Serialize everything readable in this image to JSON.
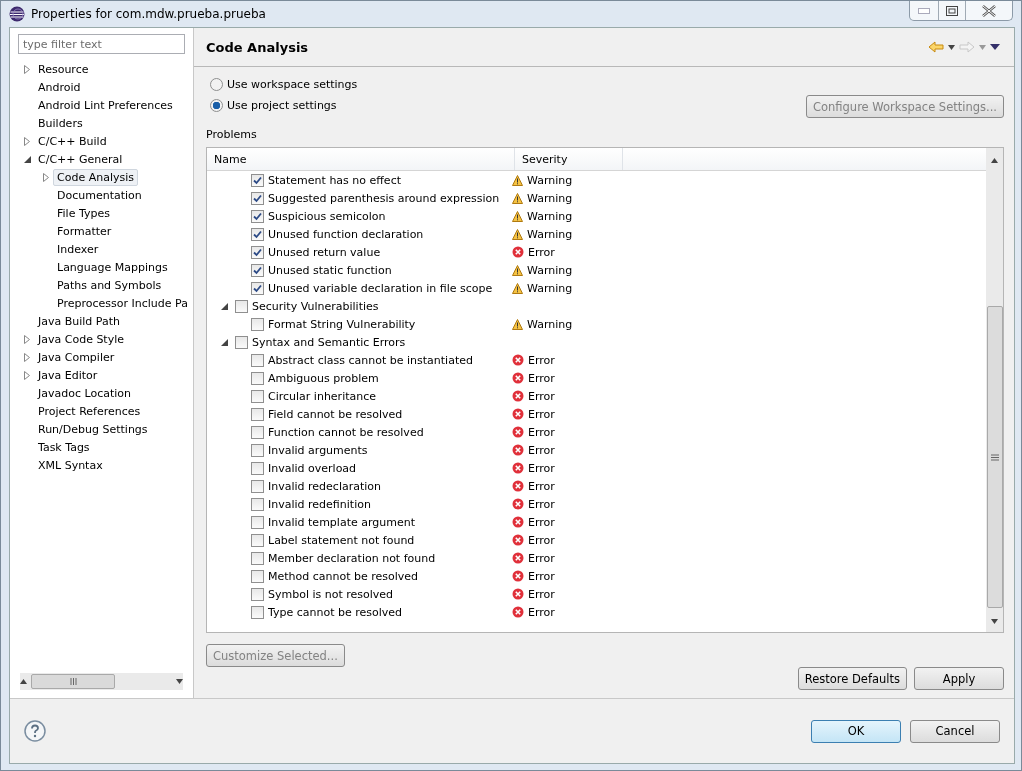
{
  "window": {
    "title": "Properties for com.mdw.prueba.prueba"
  },
  "filter": {
    "placeholder": "type filter text"
  },
  "tree": [
    {
      "label": "Resource",
      "expanded": false,
      "selected": false
    },
    {
      "label": "Android",
      "selected": false
    },
    {
      "label": "Android Lint Preferences",
      "selected": false
    },
    {
      "label": "Builders",
      "selected": false
    },
    {
      "label": "C/C++ Build",
      "expanded": false,
      "selected": false
    },
    {
      "label": "C/C++ General",
      "expanded": true,
      "selected": false,
      "children": [
        {
          "label": "Code Analysis",
          "expanded": false,
          "selected": true
        },
        {
          "label": "Documentation",
          "selected": false
        },
        {
          "label": "File Types",
          "selected": false
        },
        {
          "label": "Formatter",
          "selected": false
        },
        {
          "label": "Indexer",
          "selected": false
        },
        {
          "label": "Language Mappings",
          "selected": false
        },
        {
          "label": "Paths and Symbols",
          "selected": false
        },
        {
          "label": "Preprocessor Include Pa",
          "selected": false
        }
      ]
    },
    {
      "label": "Java Build Path",
      "selected": false
    },
    {
      "label": "Java Code Style",
      "expanded": false,
      "selected": false
    },
    {
      "label": "Java Compiler",
      "expanded": false,
      "selected": false
    },
    {
      "label": "Java Editor",
      "expanded": false,
      "selected": false
    },
    {
      "label": "Javadoc Location",
      "selected": false
    },
    {
      "label": "Project References",
      "selected": false
    },
    {
      "label": "Run/Debug Settings",
      "selected": false
    },
    {
      "label": "Task Tags",
      "selected": false
    },
    {
      "label": "XML Syntax",
      "selected": false
    }
  ],
  "page": {
    "title": "Code Analysis"
  },
  "settings": [
    {
      "label": "Use workspace settings",
      "selected": false
    },
    {
      "label": "Use project settings",
      "selected": true
    }
  ],
  "configure_button": {
    "label": "Configure Workspace Settings...",
    "disabled": true
  },
  "problems_label": "Problems",
  "table": {
    "columns": [
      "Name",
      "Severity"
    ],
    "scrolled_rows": [
      {
        "name": "Statement has no effect",
        "checked": true,
        "severity": {
          "kind": "warning",
          "label": "Warning"
        }
      },
      {
        "name": "Suggested parenthesis around expression",
        "checked": true,
        "severity": {
          "kind": "warning",
          "label": "Warning"
        }
      },
      {
        "name": "Suspicious semicolon",
        "checked": true,
        "severity": {
          "kind": "warning",
          "label": "Warning"
        }
      },
      {
        "name": "Unused function declaration",
        "checked": true,
        "severity": {
          "kind": "warning",
          "label": "Warning"
        }
      },
      {
        "name": "Unused return value",
        "checked": true,
        "severity": {
          "kind": "error",
          "label": "Error"
        }
      },
      {
        "name": "Unused static function",
        "checked": true,
        "severity": {
          "kind": "warning",
          "label": "Warning"
        }
      },
      {
        "name": "Unused variable declaration in file scope",
        "checked": true,
        "severity": {
          "kind": "warning",
          "label": "Warning"
        }
      }
    ],
    "groups": [
      {
        "name": "Security Vulnerabilities",
        "checked": false,
        "expanded": true,
        "children": [
          {
            "name": "Format String Vulnerability",
            "checked": false,
            "severity": {
              "kind": "warning",
              "label": "Warning"
            }
          }
        ]
      },
      {
        "name": "Syntax and Semantic Errors",
        "checked": false,
        "expanded": true,
        "children": [
          {
            "name": "Abstract class cannot be instantiated",
            "checked": false,
            "severity": {
              "kind": "error",
              "label": "Error"
            }
          },
          {
            "name": "Ambiguous problem",
            "checked": false,
            "severity": {
              "kind": "error",
              "label": "Error"
            }
          },
          {
            "name": "Circular inheritance",
            "checked": false,
            "severity": {
              "kind": "error",
              "label": "Error"
            }
          },
          {
            "name": "Field cannot be resolved",
            "checked": false,
            "severity": {
              "kind": "error",
              "label": "Error"
            }
          },
          {
            "name": "Function cannot be resolved",
            "checked": false,
            "severity": {
              "kind": "error",
              "label": "Error"
            }
          },
          {
            "name": "Invalid arguments",
            "checked": false,
            "severity": {
              "kind": "error",
              "label": "Error"
            }
          },
          {
            "name": "Invalid overload",
            "checked": false,
            "severity": {
              "kind": "error",
              "label": "Error"
            }
          },
          {
            "name": "Invalid redeclaration",
            "checked": false,
            "severity": {
              "kind": "error",
              "label": "Error"
            }
          },
          {
            "name": "Invalid redefinition",
            "checked": false,
            "severity": {
              "kind": "error",
              "label": "Error"
            }
          },
          {
            "name": "Invalid template argument",
            "checked": false,
            "severity": {
              "kind": "error",
              "label": "Error"
            }
          },
          {
            "name": "Label statement not found",
            "checked": false,
            "severity": {
              "kind": "error",
              "label": "Error"
            }
          },
          {
            "name": "Member declaration not found",
            "checked": false,
            "severity": {
              "kind": "error",
              "label": "Error"
            }
          },
          {
            "name": "Method cannot be resolved",
            "checked": false,
            "severity": {
              "kind": "error",
              "label": "Error"
            }
          },
          {
            "name": "Symbol is not resolved",
            "checked": false,
            "severity": {
              "kind": "error",
              "label": "Error"
            }
          },
          {
            "name": "Type cannot be resolved",
            "checked": false,
            "severity": {
              "kind": "error",
              "label": "Error"
            }
          }
        ]
      }
    ]
  },
  "customize_button": {
    "label": "Customize Selected...",
    "disabled": true
  },
  "page_buttons": [
    {
      "label": "Restore Defaults"
    },
    {
      "label": "Apply"
    }
  ],
  "dialog_buttons": [
    {
      "label": "OK",
      "default": true
    },
    {
      "label": "Cancel",
      "default": false
    }
  ]
}
